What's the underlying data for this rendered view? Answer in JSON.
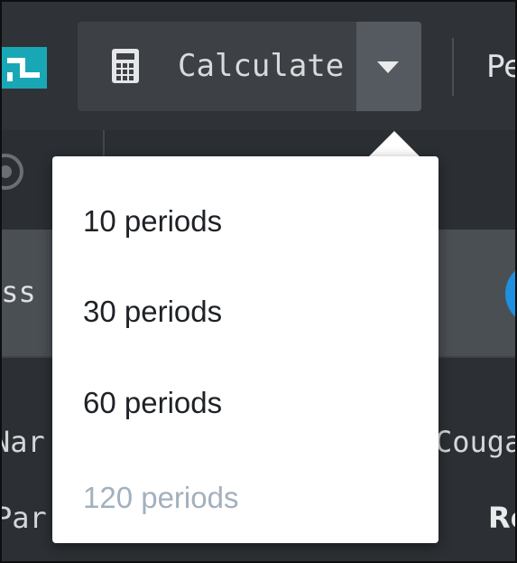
{
  "toolbar": {
    "calculate_label": "Calculate",
    "next_tab_label": "Pe"
  },
  "background": {
    "row_b_text": "ass",
    "cells": {
      "name": "Nar",
      "cougar": "Couga",
      "par": "Par",
      "ro": "Ro"
    }
  },
  "menu": {
    "items": [
      {
        "label": "10 periods",
        "enabled": true
      },
      {
        "label": "30 periods",
        "enabled": true
      },
      {
        "label": "60 periods",
        "enabled": true
      },
      {
        "label": "120 periods",
        "enabled": false
      }
    ]
  },
  "colors": {
    "accent_teal": "#1aa7b5",
    "accent_blue": "#1f8fe0",
    "disabled_text": "#a3b0bd"
  },
  "icons": {
    "app": "app-logo-icon",
    "calculate": "calculator-icon",
    "dropdown": "caret-down-icon"
  }
}
